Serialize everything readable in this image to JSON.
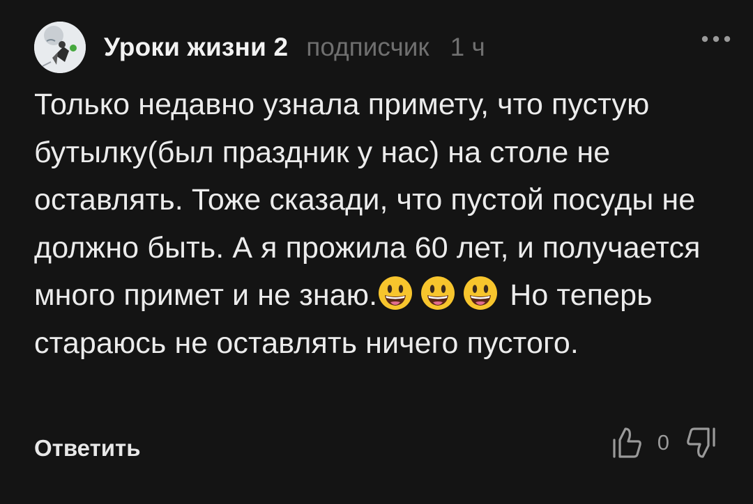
{
  "comment": {
    "author": "Уроки жизни 2",
    "role": "подписчик",
    "time": "1 ч",
    "text_before": "Только недавно узнала примету, что пустую бутылку(был праздник у нас) на столе не оставлять. Тоже сказади, что пустой посуды не должно быть. А я прожила 60 лет, и получается много примет и не знаю.",
    "emojis": [
      "grinning-face-icon",
      "grinning-face-icon",
      "grinning-face-icon"
    ],
    "text_after": "Но теперь стараюсь не оставлять ничего пустого.",
    "score": "0"
  },
  "actions": {
    "reply_label": "Ответить",
    "more_icon": "more-horizontal-icon",
    "like_icon": "thumbs-up-icon",
    "dislike_icon": "thumbs-down-icon"
  },
  "colors": {
    "background": "#141414",
    "text": "#ececec",
    "muted": "#6f6f6f"
  }
}
